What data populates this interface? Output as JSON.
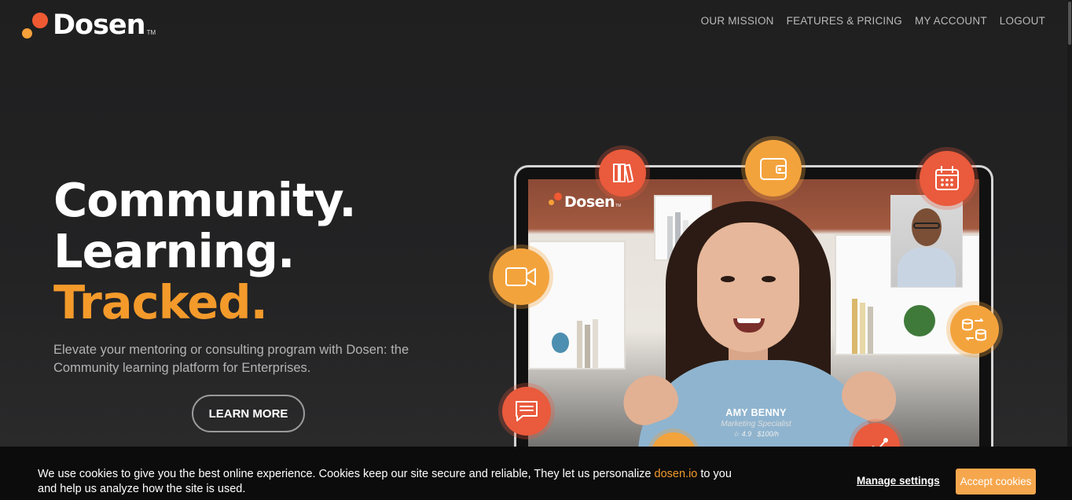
{
  "header": {
    "logo_text": "Dosen",
    "logo_tm": "TM",
    "nav": [
      "OUR MISSION",
      "FEATURES & PRICING",
      "MY ACCOUNT",
      "LOGOUT"
    ]
  },
  "hero": {
    "headline_1": "Community.",
    "headline_2": "Learning.",
    "headline_3": "Tracked.",
    "subtitle": "Elevate your mentoring or consulting program with Dosen: the Community learning platform for Enterprises.",
    "cta_label": "LEARN MORE"
  },
  "mockup": {
    "video_logo_text": "Dosen",
    "video_logo_tm": "TM",
    "person_name": "AMY BENNY",
    "person_role": "Marketing Specialist",
    "rating": "4.9",
    "rate": "$100/h",
    "icons": [
      "books-icon",
      "wallet-icon",
      "calendar-icon",
      "video-camera-icon",
      "coins-exchange-icon",
      "chat-icon",
      "chart-icon",
      "share-icon"
    ]
  },
  "cookie_bar": {
    "text_before": "We use cookies to give you the best online experience. Cookies keep our site secure and reliable, They let us personalize ",
    "link_text": "dosen.io",
    "text_after": " to you and help us analyze how the site is used.",
    "manage_label": "Manage settings",
    "accept_label": "Accept cookies"
  },
  "colors": {
    "accent_orange": "#f39a2b",
    "red": "#ea5a3c",
    "amber": "#f3a33c",
    "background": "#232324"
  }
}
